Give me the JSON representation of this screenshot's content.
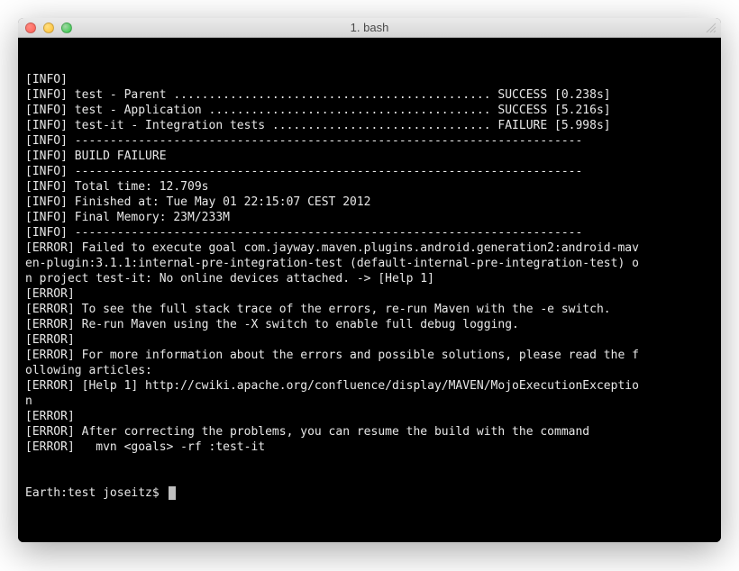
{
  "window": {
    "title": "1. bash"
  },
  "terminal": {
    "lines": [
      "[INFO]",
      "[INFO] test - Parent ............................................. SUCCESS [0.238s]",
      "[INFO] test - Application ........................................ SUCCESS [5.216s]",
      "[INFO] test-it - Integration tests ............................... FAILURE [5.998s]",
      "[INFO] ------------------------------------------------------------------------",
      "[INFO] BUILD FAILURE",
      "[INFO] ------------------------------------------------------------------------",
      "[INFO] Total time: 12.709s",
      "[INFO] Finished at: Tue May 01 22:15:07 CEST 2012",
      "[INFO] Final Memory: 23M/233M",
      "[INFO] ------------------------------------------------------------------------",
      "[ERROR] Failed to execute goal com.jayway.maven.plugins.android.generation2:android-mav",
      "en-plugin:3.1.1:internal-pre-integration-test (default-internal-pre-integration-test) o",
      "n project test-it: No online devices attached. -> [Help 1]",
      "[ERROR]",
      "[ERROR] To see the full stack trace of the errors, re-run Maven with the -e switch.",
      "[ERROR] Re-run Maven using the -X switch to enable full debug logging.",
      "[ERROR]",
      "[ERROR] For more information about the errors and possible solutions, please read the f",
      "ollowing articles:",
      "[ERROR] [Help 1] http://cwiki.apache.org/confluence/display/MAVEN/MojoExecutionExceptio",
      "n",
      "[ERROR]",
      "[ERROR] After correcting the problems, you can resume the build with the command",
      "[ERROR]   mvn <goals> -rf :test-it"
    ],
    "prompt": "Earth:test joseitz$ "
  }
}
